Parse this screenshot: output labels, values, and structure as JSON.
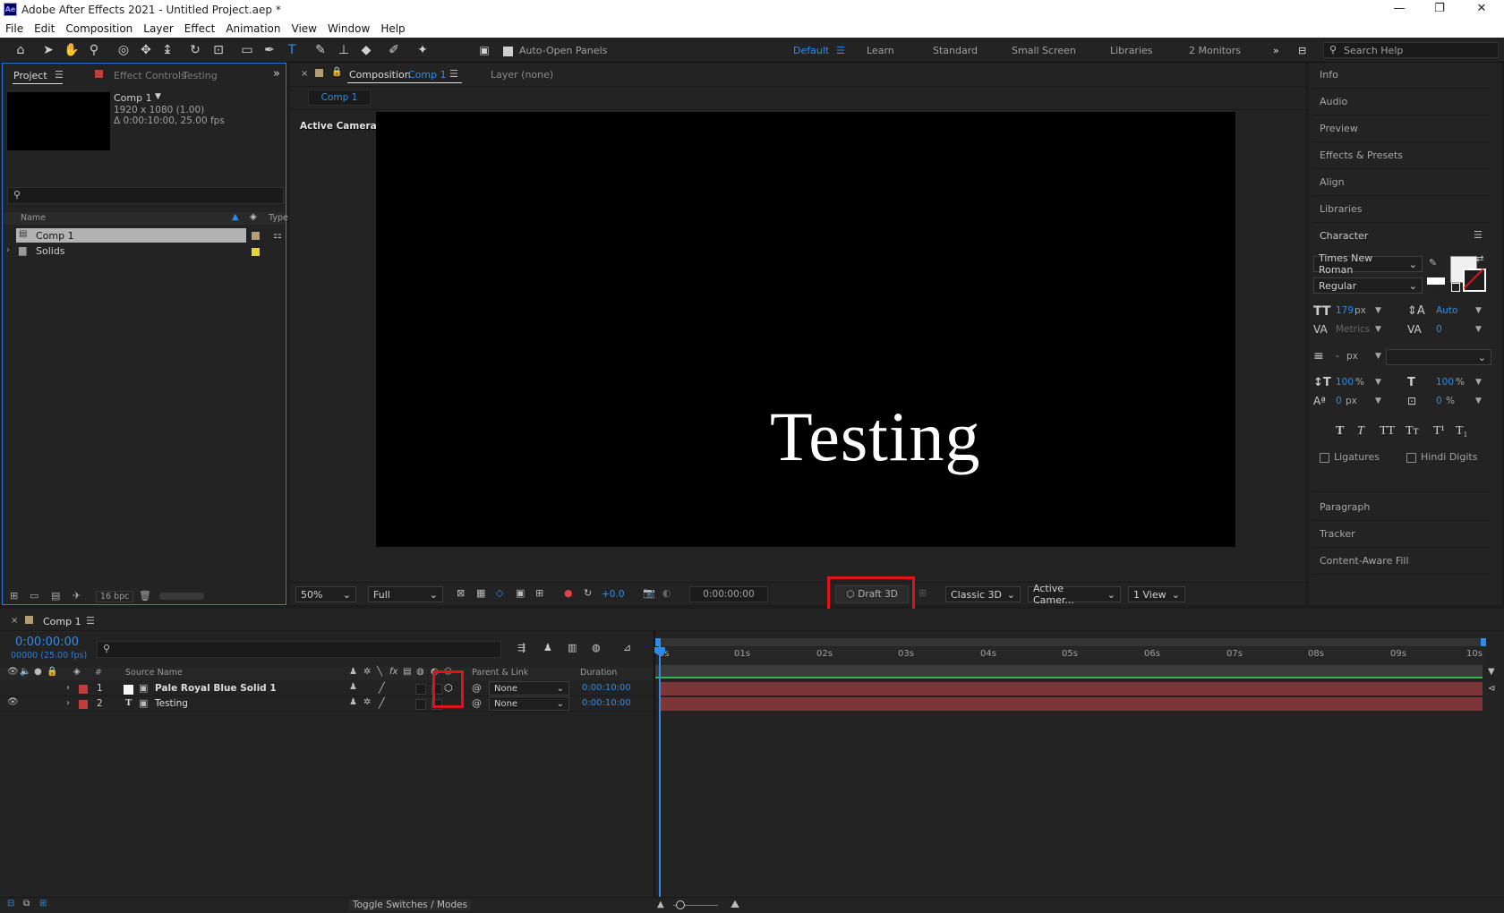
{
  "app": {
    "title": "Adobe After Effects 2021 - Untitled Project.aep *",
    "logo": "Ae"
  },
  "window_controls": [
    "—",
    "❐",
    "✕"
  ],
  "menu": [
    "File",
    "Edit",
    "Composition",
    "Layer",
    "Effect",
    "Animation",
    "View",
    "Window",
    "Help"
  ],
  "toolbar": {
    "auto_open": "Auto-Open Panels",
    "workspaces": [
      "Default",
      "Learn",
      "Standard",
      "Small Screen",
      "Libraries",
      "2 Monitors"
    ],
    "active_workspace": "Default",
    "search_placeholder": "Search Help"
  },
  "project": {
    "tab": "Project",
    "effect_tab": "Effect Controls",
    "effect_target": "Testing",
    "comp_name": "Comp 1",
    "comp_info1": "1920 x 1080 (1.00)",
    "comp_info2": "Δ 0:00:10:00, 25.00 fps",
    "col_name": "Name",
    "col_type": "Type",
    "items": [
      {
        "name": "Comp 1",
        "label_color": "#b39d74"
      },
      {
        "name": "Solids",
        "label_color": "#e6d23a"
      }
    ],
    "bpc": "16 bpc"
  },
  "composition": {
    "tab_label": "Composition",
    "tab_comp": "Comp 1",
    "layer_tab": "Layer (none)",
    "sub_tab": "Comp 1",
    "camera_label": "Active Camera (Default)",
    "text": "Testing",
    "zoom": "50%",
    "resolution": "Full",
    "exposure": "+0.0",
    "timecode": "0:00:00:00",
    "draft3d": "Draft 3D",
    "renderer": "Classic 3D",
    "camera": "Active Camer...",
    "views": "1 View"
  },
  "right_panels": {
    "top": [
      "Info",
      "Audio",
      "Preview",
      "Effects & Presets",
      "Align",
      "Libraries"
    ],
    "character": {
      "title": "Character",
      "font": "Times New Roman",
      "style": "Regular",
      "size": "179",
      "size_unit": "px",
      "leading": "Auto",
      "kerning": "Metrics",
      "tracking": "0",
      "stroke": "-",
      "stroke_unit": "px",
      "vscale": "100",
      "vscale_unit": "%",
      "hscale": "100",
      "hscale_unit": "%",
      "baseline": "0",
      "baseline_unit": "px",
      "tsume": "0",
      "tsume_unit": "%",
      "styles": [
        "T",
        "T",
        "TT",
        "Tт",
        "T¹",
        "T₁"
      ],
      "ligatures": "Ligatures",
      "hindi": "Hindi Digits"
    },
    "bottom": [
      "Paragraph",
      "Tracker",
      "Content-Aware Fill"
    ]
  },
  "timeline": {
    "tab": "Comp 1",
    "timecode": "0:00:00:00",
    "frames": "00000 (25.00 fps)",
    "cols": {
      "num": "#",
      "source": "Source Name",
      "parent": "Parent & Link",
      "duration": "Duration"
    },
    "layers": [
      {
        "num": "1",
        "name": "Pale Royal Blue Solid 1",
        "parent": "None",
        "duration": "0:00:10:00",
        "icon": "▣"
      },
      {
        "num": "2",
        "name": "Testing",
        "parent": "None",
        "duration": "0:00:10:00",
        "icon": "T"
      }
    ],
    "ruler": [
      "0s",
      "01s",
      "02s",
      "03s",
      "04s",
      "05s",
      "06s",
      "07s",
      "08s",
      "09s",
      "10s"
    ],
    "toggle": "Toggle Switches / Modes"
  },
  "colors": {
    "accent": "#2d8ceb",
    "highlight": "#e0121b",
    "layer_bar": "#7d3638",
    "label_red": "#c43d3d"
  }
}
